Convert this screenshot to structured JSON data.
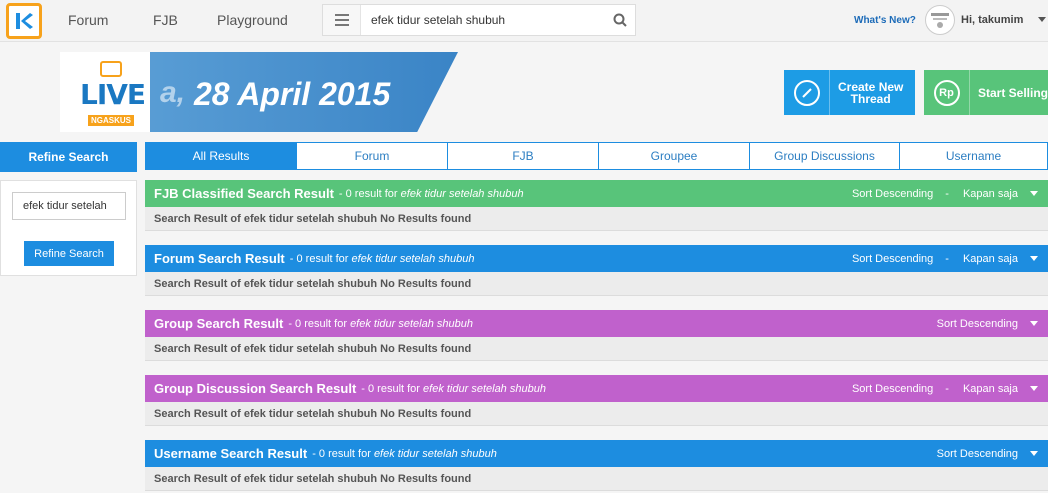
{
  "header": {
    "nav": [
      "Forum",
      "FJB",
      "Playground"
    ],
    "search_value": "efek tidur setelah shubuh",
    "whats_new": "What's New?",
    "greeting": "Hi, takumim"
  },
  "banner": {
    "live": "LIVE",
    "ngaskus": "NGASKUS",
    "date_prefix": "a,",
    "date": "28 April 2015",
    "create_thread_line1": "Create New",
    "create_thread_line2": "Thread",
    "start_selling": "Start Selling",
    "rp_label": "Rp"
  },
  "sidebar": {
    "title": "Refine Search",
    "input_value": "efek tidur setelah",
    "button": "Refine Search"
  },
  "tabs": [
    "All Results",
    "Forum",
    "FJB",
    "Groupee",
    "Group Discussions",
    "Username"
  ],
  "results": [
    {
      "title": "FJB Classified Search Result",
      "meta": "- 0 result for",
      "query": "efek tidur setelah shubuh",
      "sort": "Sort Descending",
      "time": "Kapan saja",
      "body": "Search Result of efek tidur setelah shubuh No Results found"
    },
    {
      "title": "Forum Search Result",
      "meta": "- 0 result for",
      "query": "efek tidur setelah shubuh",
      "sort": "Sort Descending",
      "time": "Kapan saja",
      "body": "Search Result of efek tidur setelah shubuh No Results found"
    },
    {
      "title": "Group Search Result",
      "meta": "- 0 result for",
      "query": "efek tidur setelah shubuh",
      "sort": "Sort Descending",
      "time": "",
      "body": "Search Result of efek tidur setelah shubuh No Results found"
    },
    {
      "title": "Group Discussion Search Result",
      "meta": "- 0 result for",
      "query": "efek tidur setelah shubuh",
      "sort": "Sort Descending",
      "time": "Kapan saja",
      "body": "Search Result of efek tidur setelah shubuh No Results found"
    },
    {
      "title": "Username Search Result",
      "meta": "- 0 result for",
      "query": "efek tidur setelah shubuh",
      "sort": "Sort Descending",
      "time": "",
      "body": "Search Result of efek tidur setelah shubuh No Results found"
    }
  ],
  "colors": {
    "green": "#58c47a",
    "blue": "#1d8de0",
    "purple": "#c061cc",
    "brand_orange": "#f7a21b"
  }
}
